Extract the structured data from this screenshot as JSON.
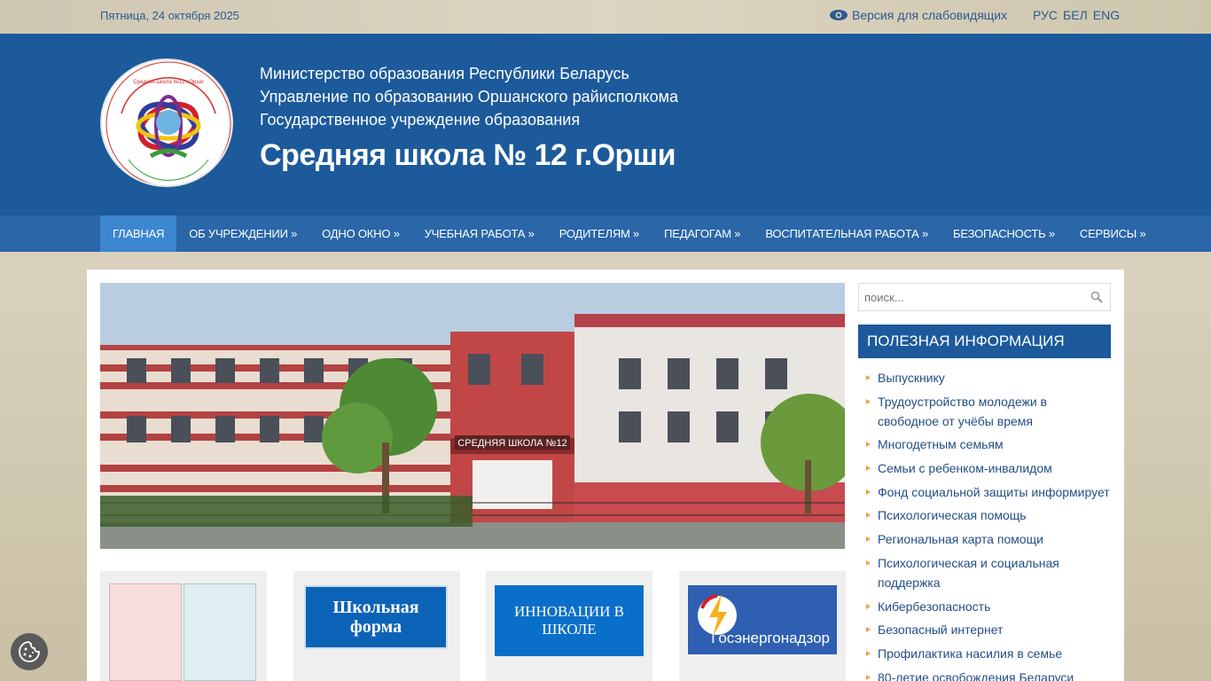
{
  "topbar": {
    "date": "Пятница, 24 октября 2025",
    "vision_label": "Версия для слабовидящих",
    "languages": [
      "РУС",
      "БЕЛ",
      "ENG"
    ]
  },
  "header": {
    "line1": "Министерство образования Республики Беларусь",
    "line2": "Управление по образованию Оршанского райисполкома",
    "line3": "Государственное учреждение образования",
    "title": "Средняя школа № 12 г.Орши"
  },
  "nav": {
    "items": [
      "Главная",
      "Об учреждении  »",
      "Одно окно  »",
      "Учебная работа  »",
      "Родителям  »",
      "Педагогам  »",
      "Воспитательная работа  »",
      "Безопасность  »",
      "Сервисы  »"
    ]
  },
  "hero": {
    "sign": "СРЕДНЯЯ  ШКОЛА  №12"
  },
  "tiles": [
    {
      "name": "certificates",
      "text": ""
    },
    {
      "name": "school-uniform",
      "text": "Школьная форма",
      "color": "#0b63b8"
    },
    {
      "name": "innovations",
      "text": "ИННОВАЦИИ В ШКОЛЕ",
      "color": "#0a6fc9"
    },
    {
      "name": "gosenergonadzor",
      "text": "Госэнергонадзор",
      "color": "#2f5fb3"
    }
  ],
  "sidebar": {
    "search_placeholder": "поиск...",
    "title": "Полезная информация",
    "items": [
      "Выпускнику",
      "Трудоустройство молодежи в свободное от учёбы время",
      "Многодетным семьям",
      "Семьи с ребенком-инвалидом",
      "Фонд социальной защиты информирует",
      "Психологическая помощь",
      "Региональная карта помощи",
      "Психологическая и социальная поддержка",
      "Кибербезопасность",
      "Безопасный интернет",
      "Профилактика насилия в семье",
      "80-летие освобождения Беларуси"
    ]
  },
  "colors": {
    "header": "#1c5a9c",
    "nav": "#2a66a8",
    "nav_active": "#3d86d0",
    "link": "#234e85"
  }
}
